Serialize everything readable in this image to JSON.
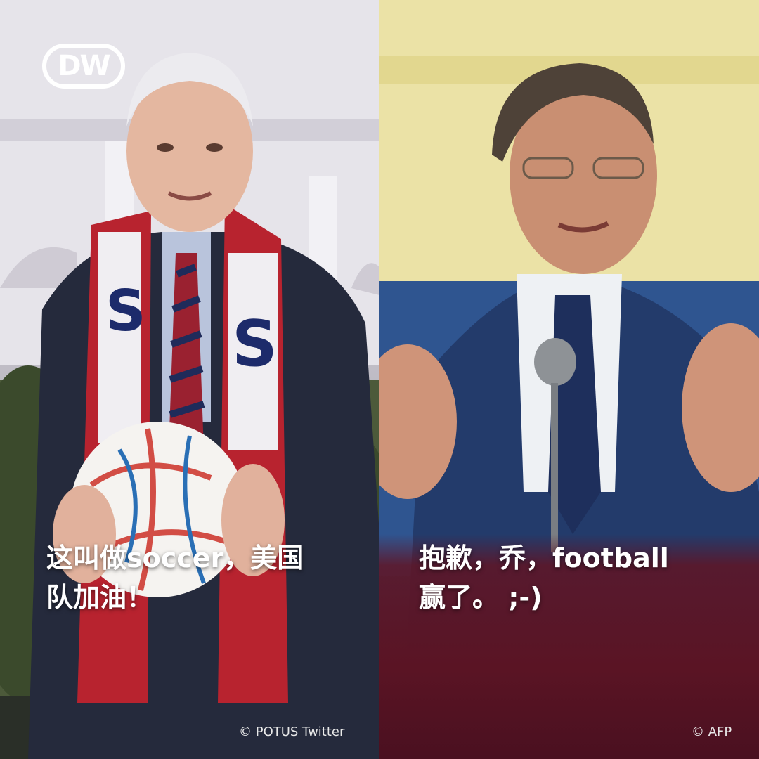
{
  "brand": {
    "logo_icon": "dw-logo-icon",
    "logo_text": "DW",
    "accent_maroon": "#5a1424"
  },
  "left_panel": {
    "caption_line1": "这叫做soccer，美国",
    "caption_line2": "队加油！",
    "credit": "© POTUS Twitter"
  },
  "right_panel": {
    "caption_line1": "抱歉，乔，football",
    "caption_line2": "赢了。 ;-)",
    "credit": "© AFP"
  }
}
